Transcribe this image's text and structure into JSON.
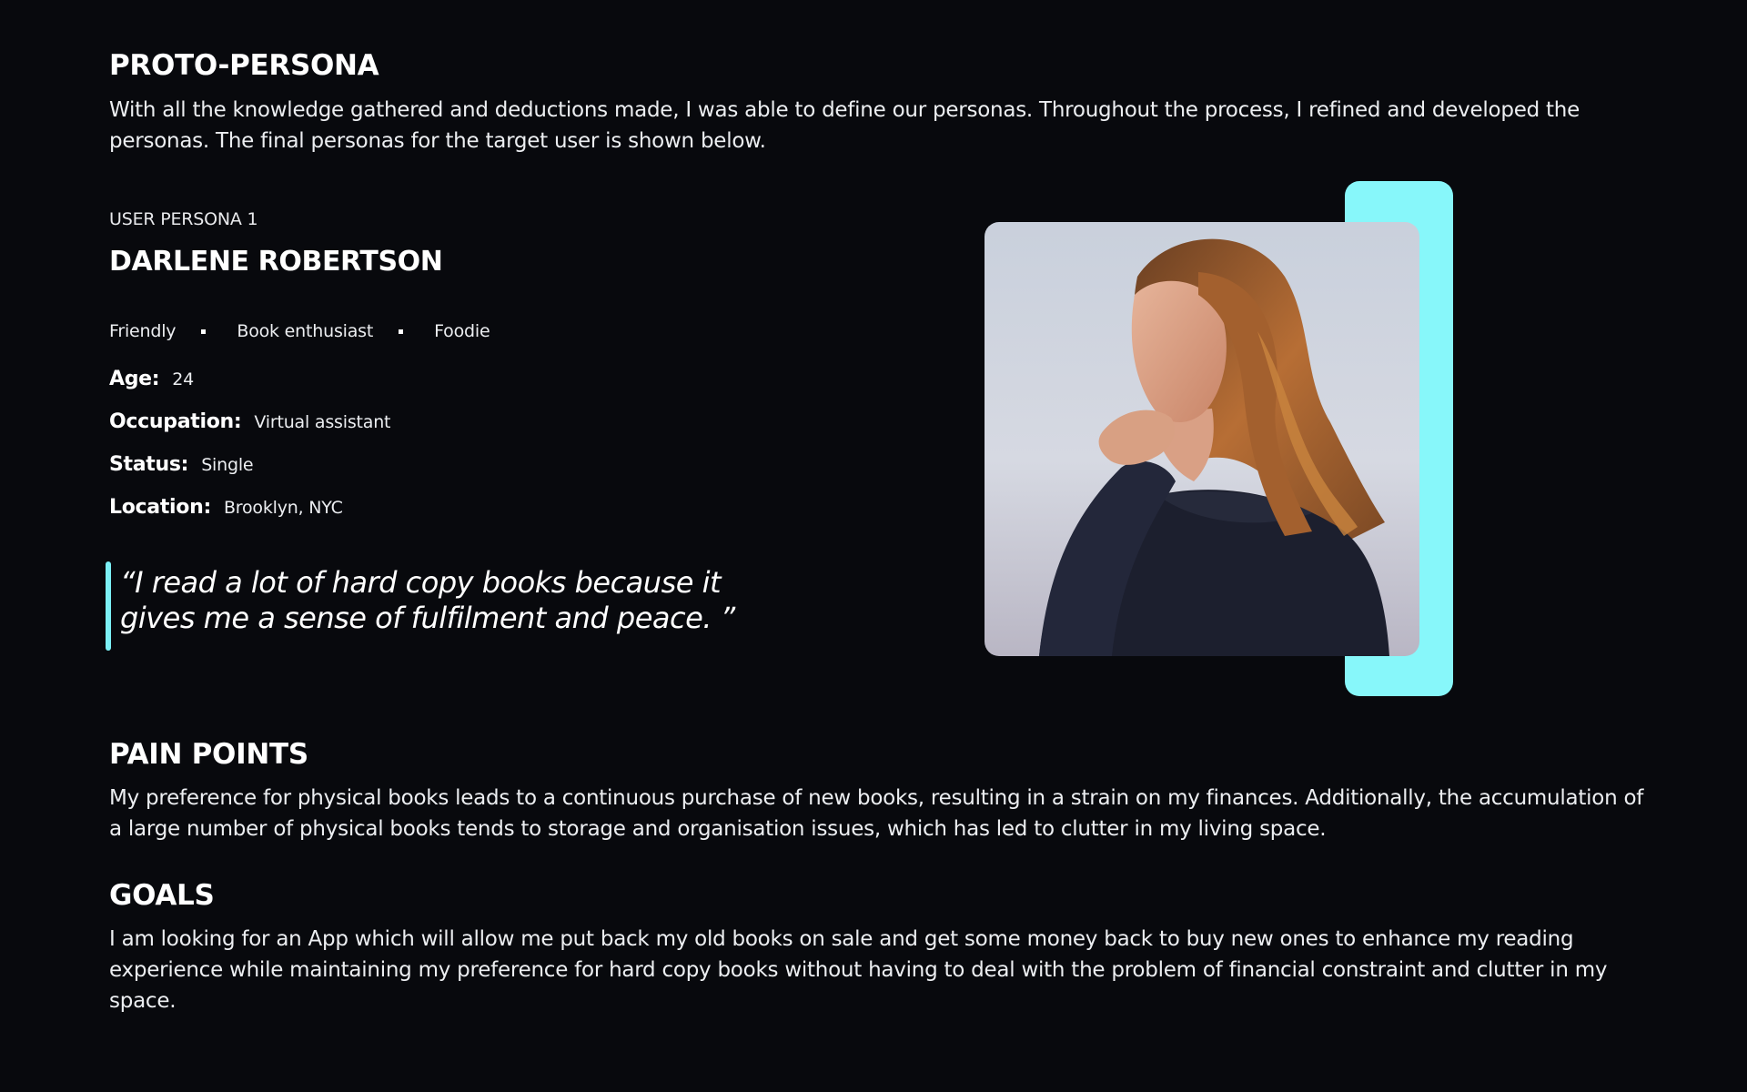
{
  "proto_persona": {
    "heading": "PROTO-PERSONA",
    "intro": "With all the knowledge gathered and deductions made, I was able to define our personas. Throughout the process, I refined and developed the personas. The final personas for the target user is shown below."
  },
  "persona": {
    "kicker": "USER PERSONA 1",
    "name": "DARLENE ROBERTSON",
    "traits": [
      "Friendly",
      "Book enthusiast",
      "Foodie"
    ],
    "attributes": {
      "age": {
        "label": "Age:",
        "value": "24"
      },
      "occupation": {
        "label": "Occupation:",
        "value": "Virtual assistant"
      },
      "status": {
        "label": "Status:",
        "value": "Single"
      },
      "location": {
        "label": "Location:",
        "value": "Brooklyn, NYC"
      }
    },
    "quote": "“I read a lot of hard copy books because it gives me a sense of fulfilment and peace. ”"
  },
  "pain_points": {
    "heading": "PAIN POINTS",
    "text": "My preference for physical books leads to a continuous purchase of new books, resulting in a strain on my finances. Additionally, the accumulation of a large number of physical books tends to storage and organisation issues, which has led to clutter in my living space."
  },
  "goals": {
    "heading": "GOALS",
    "text": "I am looking for an App which will allow me put back my old books on sale and get some money back to buy new ones to enhance my reading experience while maintaining my preference for hard copy books without having to deal with the problem of financial constraint and clutter in my space."
  },
  "colors": {
    "background": "#08090d",
    "accent": "#87f7fa",
    "text": "#ffffff"
  }
}
